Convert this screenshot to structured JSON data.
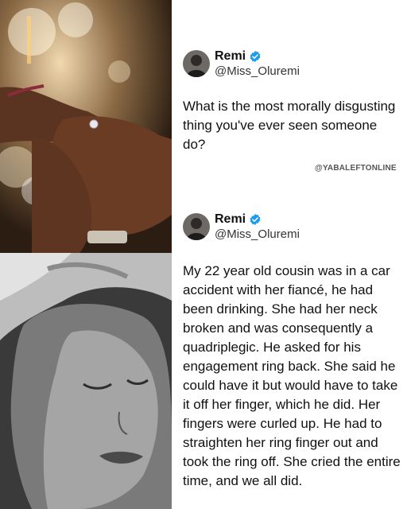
{
  "tweets": [
    {
      "name": "Remi",
      "handle": "@Miss_Oluremi",
      "text": "What is the most morally disgusting thing you've ever seen someone do?"
    },
    {
      "name": "Remi",
      "handle": "@Miss_Oluremi",
      "text": "My 22 year old cousin was in a car accident with her fiancé, he had been drinking. She had her neck broken and was consequently a quadriplegic. He asked for his engagement ring back. She said he could have it but would have to take it off her finger, which he did. Her fingers were curled up. He had to straighten her ring finger out and took the ring off. She cried the entire time, and we all did."
    }
  ],
  "watermark": "@YABALEFTONLINE",
  "icons": {
    "verified": "verified-badge-icon"
  },
  "colors": {
    "verified": "#1d9bf0",
    "text": "#111111",
    "handle": "#333333"
  }
}
